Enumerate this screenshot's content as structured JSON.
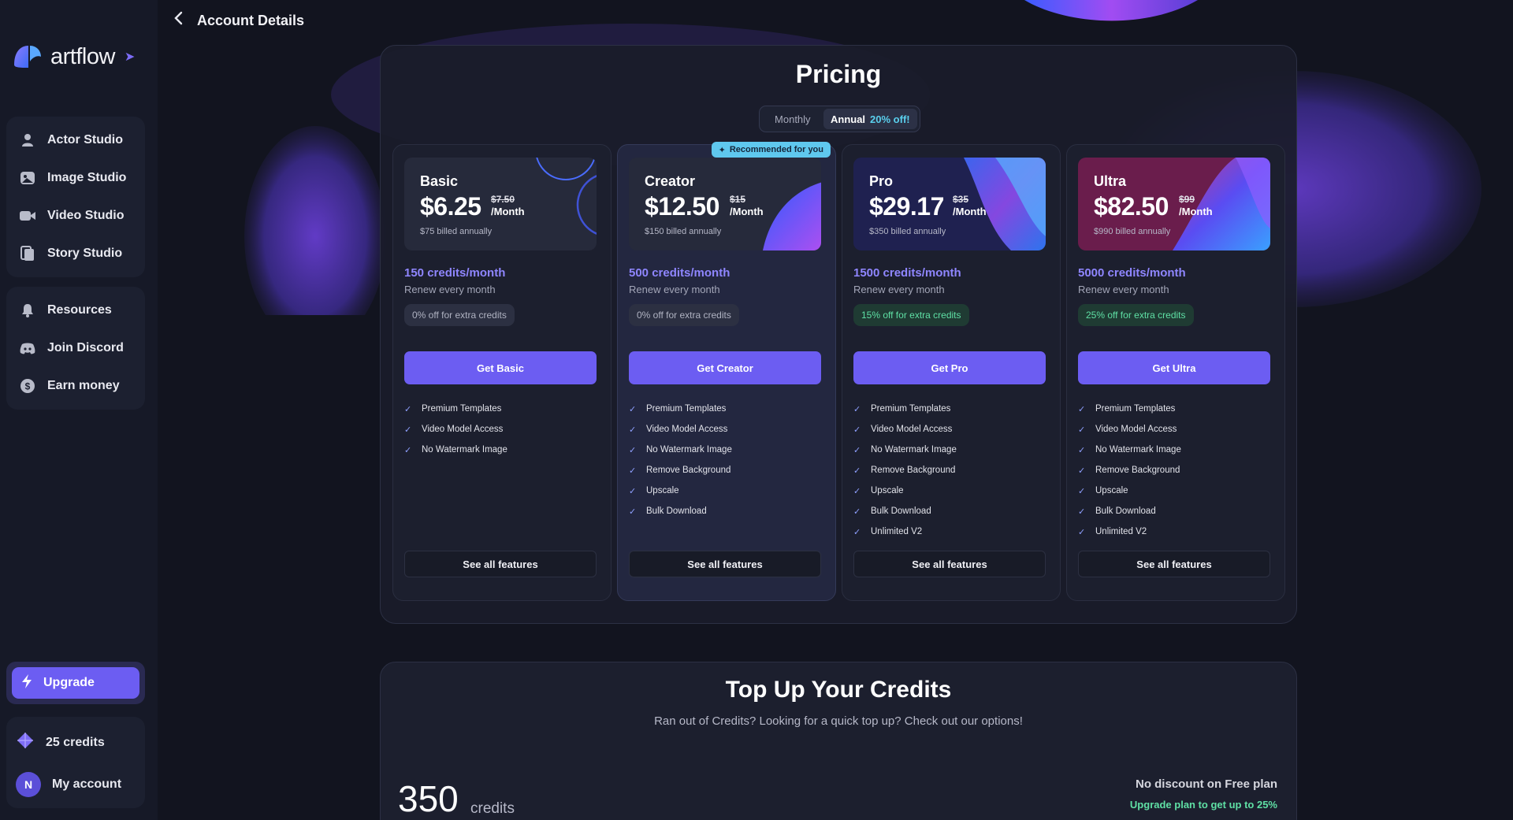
{
  "app": {
    "name": "artflow"
  },
  "header": {
    "title": "Account Details",
    "back_icon": "chevron-left-icon"
  },
  "sidebar": {
    "studios": [
      {
        "label": "Actor Studio",
        "icon": "person-icon"
      },
      {
        "label": "Image Studio",
        "icon": "image-icon"
      },
      {
        "label": "Video Studio",
        "icon": "video-camera-icon"
      },
      {
        "label": "Story Studio",
        "icon": "book-icon"
      }
    ],
    "community": [
      {
        "label": "Resources",
        "icon": "bell-icon"
      },
      {
        "label": "Join Discord",
        "icon": "discord-icon"
      },
      {
        "label": "Earn money",
        "icon": "dollar-icon"
      }
    ],
    "upgrade_label": "Upgrade",
    "credits_label": "25 credits",
    "account_label": "My account",
    "avatar_initial": "N"
  },
  "pricing": {
    "title": "Pricing",
    "toggle": {
      "monthly": "Monthly",
      "annual": "Annual",
      "annual_discount": "20% off!"
    },
    "plans": [
      {
        "name": "Basic",
        "price": "$6.25",
        "old_price": "$7.50",
        "per": "/Month",
        "billed": "$75 billed annually",
        "credits": "150 credits/month",
        "renew": "Renew every month",
        "extra": "0% off for extra credits",
        "button": "Get Basic",
        "features": [
          "Premium Templates",
          "Video Model Access",
          "No Watermark Image"
        ],
        "see_all": "See all features"
      },
      {
        "name": "Creator",
        "price": "$12.50",
        "old_price": "$15",
        "per": "/Month",
        "billed": "$150 billed annually",
        "credits": "500 credits/month",
        "renew": "Renew every month",
        "extra": "0% off for extra credits",
        "button": "Get Creator",
        "features": [
          "Premium Templates",
          "Video Model Access",
          "No Watermark Image",
          "Remove Background",
          "Upscale",
          "Bulk Download"
        ],
        "see_all": "See all features",
        "badge": "Recommended for you"
      },
      {
        "name": "Pro",
        "price": "$29.17",
        "old_price": "$35",
        "per": "/Month",
        "billed": "$350 billed annually",
        "credits": "1500 credits/month",
        "renew": "Renew every month",
        "extra": "15% off for extra credits",
        "button": "Get Pro",
        "features": [
          "Premium Templates",
          "Video Model Access",
          "No Watermark Image",
          "Remove Background",
          "Upscale",
          "Bulk Download",
          "Unlimited V2"
        ],
        "see_all": "See all features"
      },
      {
        "name": "Ultra",
        "price": "$82.50",
        "old_price": "$99",
        "per": "/Month",
        "billed": "$990 billed annually",
        "credits": "5000 credits/month",
        "renew": "Renew every month",
        "extra": "25% off for extra credits",
        "button": "Get Ultra",
        "features": [
          "Premium Templates",
          "Video Model Access",
          "No Watermark Image",
          "Remove Background",
          "Upscale",
          "Bulk Download",
          "Unlimited V2"
        ],
        "see_all": "See all features"
      }
    ]
  },
  "topup": {
    "title": "Top Up Your Credits",
    "subtitle": "Ran out of Credits? Looking for a quick top up? Check out our options!",
    "amount": "350",
    "unit": "credits",
    "no_discount": "No discount on Free plan",
    "upgrade_hint": "Upgrade plan to get up to 25%"
  },
  "colors": {
    "accent": "#6c5df2",
    "credits_text": "#8f86ff",
    "green": "#5fe0a5",
    "badge": "#5fc8ee"
  }
}
